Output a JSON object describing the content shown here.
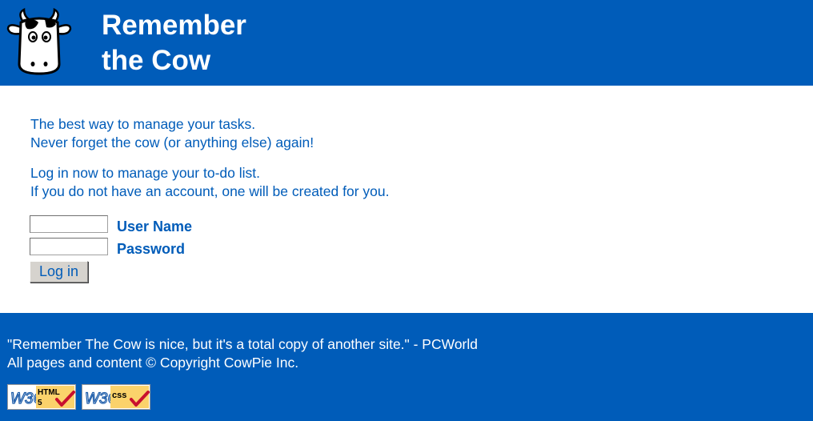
{
  "header": {
    "title_line1": "Remember",
    "title_line2": "the Cow"
  },
  "intro": {
    "line1": "The best way to manage your tasks.",
    "line2": "Never forget the cow (or anything else) again!",
    "line3": "Log in now to manage your to-do list.",
    "line4": "If you do not have an account, one will be created for you."
  },
  "login": {
    "username_label": "User Name",
    "username_value": "",
    "password_label": "Password",
    "password_value": "",
    "button_label": "Log in"
  },
  "footer": {
    "quote": "\"Remember The Cow is nice, but it's a total copy of another site.\" - PCWorld",
    "copyright": "All pages and content © Copyright CowPie Inc.",
    "badges": {
      "html5_org": "W3C",
      "html5_label": "HTML",
      "html5_version": "5",
      "css_org": "W3C",
      "css_label": "css"
    }
  },
  "colors": {
    "brand_blue": "#005cb9",
    "badge_yellow": "#fbd26b",
    "check_red": "#c8102e"
  }
}
